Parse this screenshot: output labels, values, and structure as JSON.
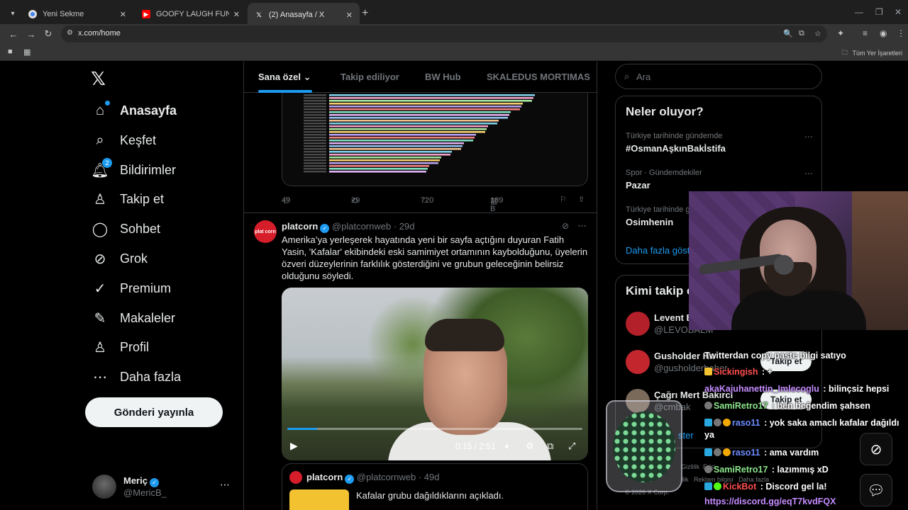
{
  "browser": {
    "tabs": [
      {
        "title": "Yeni Sekme",
        "favicon": "chrome-icon"
      },
      {
        "title": "GOOFY LAUGH FUNK (Official A",
        "favicon": "youtube-icon"
      },
      {
        "title": "(2) Anasayfa / X",
        "favicon": "x-icon"
      }
    ],
    "url": "x.com/home",
    "all_bookmarks": "Tüm Yer İşaretleri"
  },
  "sidebar": {
    "items": [
      {
        "label": "Anasayfa",
        "icon": "home-icon"
      },
      {
        "label": "Keşfet",
        "icon": "search-icon"
      },
      {
        "label": "Bildirimler",
        "icon": "bell-icon",
        "badge": "2"
      },
      {
        "label": "Takip et",
        "icon": "person-add-icon"
      },
      {
        "label": "Sohbet",
        "icon": "chat-icon"
      },
      {
        "label": "Grok",
        "icon": "grok-icon"
      },
      {
        "label": "Premium",
        "icon": "premium-icon"
      },
      {
        "label": "Makaleler",
        "icon": "articles-icon"
      },
      {
        "label": "Profil",
        "icon": "profile-icon"
      },
      {
        "label": "Daha fazla",
        "icon": "more-icon"
      }
    ],
    "post_button": "Gönderi yayınla",
    "account": {
      "name": "Meriç",
      "handle": "@MericB_"
    }
  },
  "feed": {
    "tabs": [
      "Sana özel",
      "Takip ediliyor",
      "BW Hub",
      "SKALEDUS MORTIMAS"
    ],
    "tweet1_actions": {
      "replies": "49",
      "retweets": "29",
      "likes": "720",
      "views": "189 B"
    },
    "tweet2": {
      "author": "platcorn",
      "handle": "@platcornweb",
      "time": "· 29d",
      "avatar_text": "plat corn",
      "text": "Amerika’ya yerleşerek hayatında yeni bir sayfa açtığını duyuran Fatih Yasin, 'Kafalar' ekibindeki eski samimiyet ortamının kaybolduğunu, üyelerin özveri düzeylerinin farklılık gösterdiğini ve grubun geleceğinin belirsiz olduğunu söyledi.",
      "video_time": "0:15 / 2:51"
    },
    "quote": {
      "author": "platcorn",
      "handle": "@platcornweb",
      "time": "· 49d",
      "text": "Kafalar grubu dağıldıklarını açıkladı."
    }
  },
  "right": {
    "search_placeholder": "Ara",
    "trends_title": "Neler oluyor?",
    "trends": [
      {
        "meta": "Türkiye tarihinde gündemde",
        "name": "#OsmanAşkınBakİstifa"
      },
      {
        "meta": "Spor · Gündemdekiler",
        "name": "Pazar"
      },
      {
        "meta": "Türkiye tarihinde g",
        "name": "Osimhenin"
      }
    ],
    "show_more": "Daha fazla göste",
    "who_title": "Kimi takip e",
    "who": [
      {
        "name": "Levent B",
        "handle": "@LEVOBALM"
      },
      {
        "name": "Gusholder Ha",
        "handle": "@gusholderhaber"
      },
      {
        "name": "Çağrı Mert Bakırcı",
        "handle": "@cmbak"
      }
    ],
    "follow_label": "Takip et",
    "footer": [
      "Gizlilik",
      "Erişi",
      "ilik",
      "Reklam bilgisi",
      "Daha fazla",
      "© 2026 X Corp."
    ],
    "show_more2": "ster"
  },
  "chat": {
    "lines": [
      {
        "user": "",
        "text": "Twitterdan copy paste bilgi satıyo"
      },
      {
        "user": "Sickingish",
        "text": " : +",
        "color": "#ff4d4d"
      },
      {
        "user": "akaKajuhanettin_Imlecoglu",
        "text": " : bilinçsiz hepsi",
        "color": "#c58cff"
      },
      {
        "user": "SamiRetro17",
        "text": " : ben beğendim şahsen",
        "color": "#8ce68c"
      },
      {
        "user": "raso11",
        "text": " : yok saka amaclı kafalar dağıldı ya",
        "color": "#6c8cff"
      },
      {
        "user": "raso11",
        "text": " : ama vardım",
        "color": "#6c8cff"
      },
      {
        "user": "SamiRetro17",
        "text": " : lazımmış xD",
        "color": "#8ce68c"
      },
      {
        "user": "KickBot",
        "text": " : Discord gel la!",
        "color": "#ff4d4d"
      },
      {
        "user": "",
        "text": "https://discord.gg/eqT7kvdFQX",
        "color": "#c58cff"
      }
    ]
  }
}
